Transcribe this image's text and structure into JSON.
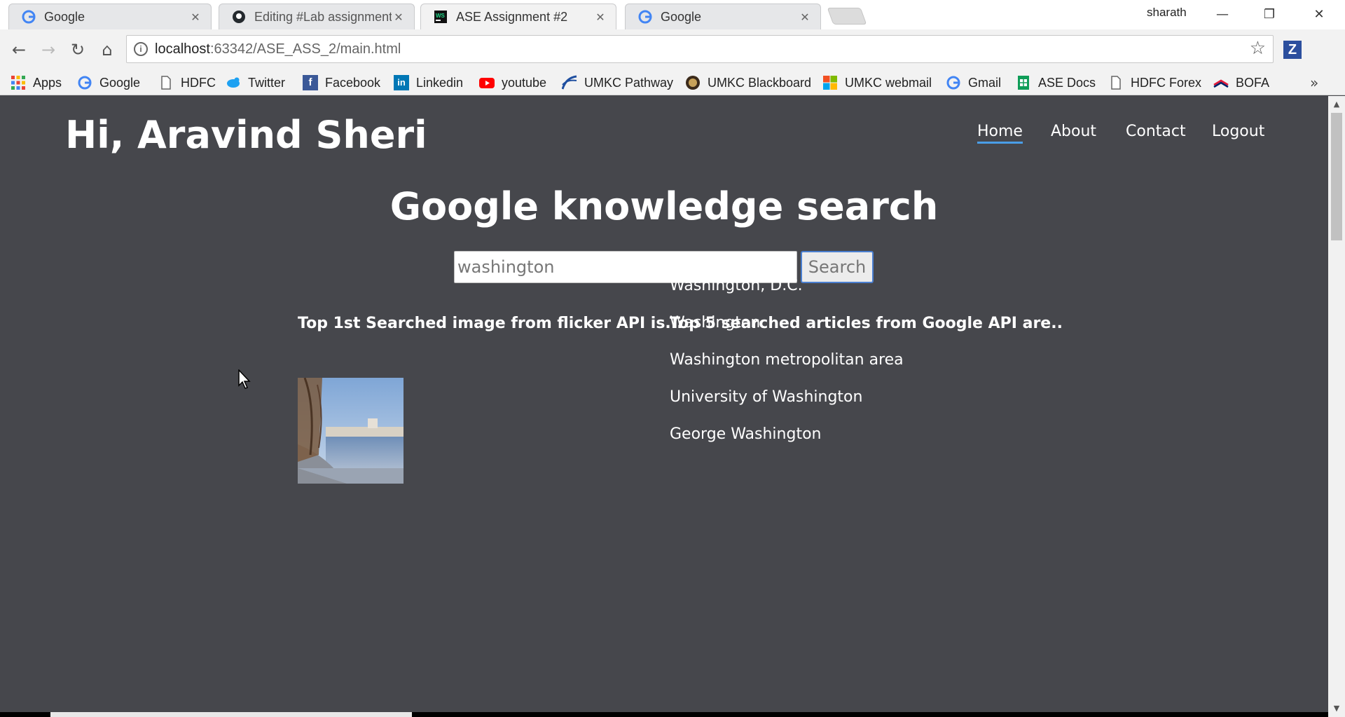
{
  "browser": {
    "tabs": [
      {
        "title": "Google",
        "favicon": "google-icon",
        "active": false
      },
      {
        "title": "Editing #Lab assignment",
        "favicon": "github-icon",
        "active": false
      },
      {
        "title": "ASE Assignment #2",
        "favicon": "webstorm-icon",
        "active": true
      },
      {
        "title": "Google",
        "favicon": "google-icon",
        "active": false
      }
    ],
    "profile_name": "sharath",
    "url_host": "localhost",
    "url_path": ":63342/ASE_ASS_2/main.html",
    "bookmarks": [
      {
        "label": "Apps",
        "icon": "apps-grid-icon"
      },
      {
        "label": "Google",
        "icon": "google-icon"
      },
      {
        "label": "HDFC",
        "icon": "page-icon"
      },
      {
        "label": "Twitter",
        "icon": "twitter-icon"
      },
      {
        "label": "Facebook",
        "icon": "facebook-icon"
      },
      {
        "label": "Linkedin",
        "icon": "linkedin-icon"
      },
      {
        "label": "youtube",
        "icon": "youtube-icon"
      },
      {
        "label": "UMKC Pathway",
        "icon": "umkc-pathway-icon"
      },
      {
        "label": "UMKC Blackboard",
        "icon": "umkc-blackboard-icon"
      },
      {
        "label": "UMKC webmail",
        "icon": "microsoft-icon"
      },
      {
        "label": "Gmail",
        "icon": "google-icon"
      },
      {
        "label": "ASE Docs",
        "icon": "sheets-icon"
      },
      {
        "label": "HDFC Forex",
        "icon": "page-icon"
      },
      {
        "label": "BOFA",
        "icon": "bofa-icon"
      }
    ]
  },
  "page": {
    "greeting": "Hi, Aravind Sheri",
    "nav": [
      {
        "label": "Home",
        "active": true
      },
      {
        "label": "About",
        "active": false
      },
      {
        "label": "Contact",
        "active": false
      },
      {
        "label": "Logout",
        "active": false
      }
    ],
    "heading": "Google knowledge search",
    "search": {
      "value": "washington",
      "button_label": "Search"
    },
    "image_column_title": "Top 1st Searched image from flicker API is...",
    "articles_column_title": "Top 5 searched articles from Google API are..",
    "articles": [
      "Washington, D.C.",
      "Washington",
      "Washington metropolitan area",
      "University of Washington",
      "George Washington"
    ]
  },
  "colors": {
    "page_background": "#46474c",
    "nav_active_underline": "#4a9ee8",
    "text": "#ffffff"
  }
}
